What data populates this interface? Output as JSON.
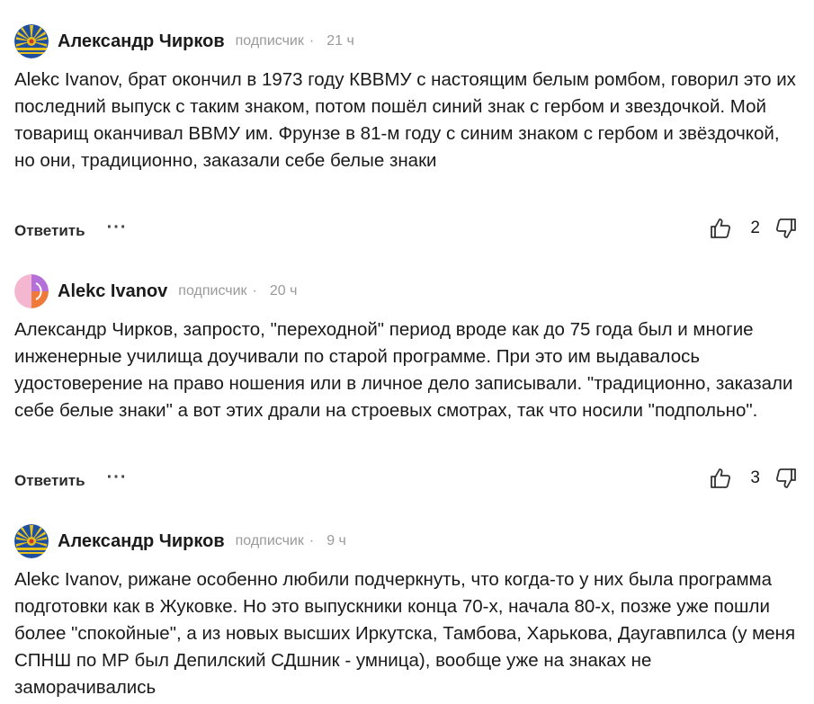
{
  "comments": [
    {
      "author": "Александр Чирков",
      "role": "подписчик",
      "separator": "·",
      "time": "21 ч",
      "text": "Alekc Ivanov, брат окончил в 1973 году КВВМУ с настоящим белым ромбом, говорил это их последний выпуск с таким  знаком, потом пошёл синий знак с гербом и звездочкой. Мой товарищ оканчивал ВВМУ им. Фрунзе в 81-м году с синим знаком с гербом и звёздочкой, но они, традиционно, заказали себе белые знаки",
      "reply_label": "Ответить",
      "more_label": "···",
      "likes": "2",
      "avatar_icon": "emblem-avatar-icon"
    },
    {
      "author": "Alekc Ivanov",
      "role": "подписчик",
      "separator": "·",
      "time": "20 ч",
      "text": "Александр Чирков, запросто, \"переходной\" период вроде как до 75 года был и многие инженерные училища доучивали по старой программе. При это им выдавалось удостоверение на право ношения или в личное дело записывали. \"традиционно, заказали себе белые знаки\" а вот этих драли на строевых смотрах, так что носили \"подпольно\".",
      "reply_label": "Ответить",
      "more_label": "···",
      "likes": "3",
      "avatar_icon": "gradient-avatar-icon"
    },
    {
      "author": "Александр Чирков",
      "role": "подписчик",
      "separator": "·",
      "time": "9 ч",
      "text": "Alekc Ivanov, рижане особенно любили подчеркнуть, что когда-то у них была программа подготовки как в Жуковке. Но это выпускники конца 70-х, начала 80-х, позже уже пошли более \"спокойные\", а из новых высших Иркутска, Тамбова, Харькова, Даугавпилса (у меня СПНШ по МР был Депилский СДшник - умница), вообще уже на знаках не заморачивались",
      "avatar_icon": "emblem-avatar-icon"
    }
  ],
  "colors": {
    "muted": "#9a9a9a",
    "text": "#1a1a1a",
    "emblem_blue": "#1e4fa0",
    "emblem_yellow": "#e8c21c",
    "avatar_pink": "#f2a8c8",
    "avatar_purple": "#9b5fd0",
    "avatar_orange": "#f07a3a"
  }
}
